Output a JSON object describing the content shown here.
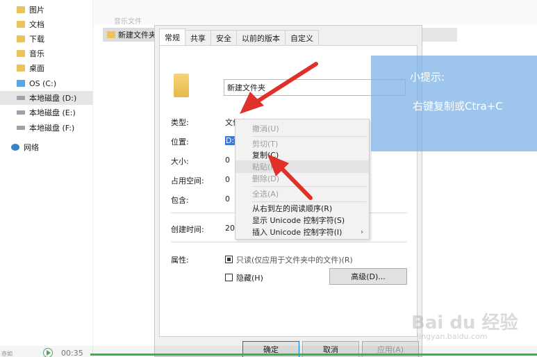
{
  "nav": {
    "items": [
      {
        "label": "图片",
        "icon": "folder-icon"
      },
      {
        "label": "文档",
        "icon": "folder-icon"
      },
      {
        "label": "下载",
        "icon": "folder-icon"
      },
      {
        "label": "音乐",
        "icon": "folder-icon"
      },
      {
        "label": "桌面",
        "icon": "folder-icon"
      },
      {
        "label": "OS (C:)",
        "icon": "windows-drive-icon"
      },
      {
        "label": "本地磁盘 (D:)",
        "icon": "drive-icon",
        "selected": true
      },
      {
        "label": "本地磁盘 (E:)",
        "icon": "drive-icon"
      },
      {
        "label": "本地磁盘 (F:)",
        "icon": "drive-icon"
      },
      {
        "label": "网络",
        "icon": "network-icon"
      }
    ]
  },
  "background": {
    "faint_item": "音乐文件",
    "selected_row": "新建文件夹"
  },
  "dialog": {
    "tabs": [
      "常规",
      "共享",
      "安全",
      "以前的版本",
      "自定义"
    ],
    "active_tab": "常规",
    "name": "新建文件夹",
    "props": {
      "type_label": "类型:",
      "type_value": "文件夹",
      "location_label": "位置:",
      "location_value": "D:\\",
      "size_label": "大小:",
      "size_value": "0",
      "size_on_disk_label": "占用空间:",
      "size_on_disk_value": "0",
      "contains_label": "包含:",
      "contains_value": "0",
      "created_label": "创建时间:",
      "created_value": "20",
      "attributes_label": "属性:"
    },
    "attributes": {
      "readonly_label": "只读(仅应用于文件夹中的文件)(R)",
      "hidden_label": "隐藏(H)",
      "advanced_button": "高级(D)..."
    },
    "buttons": {
      "ok": "确定",
      "cancel": "取消",
      "apply": "应用(A)"
    }
  },
  "context_menu": {
    "items": [
      {
        "label": "撤消(U)",
        "disabled": true
      },
      {
        "separator": true
      },
      {
        "label": "剪切(T)",
        "disabled": true
      },
      {
        "label": "复制(C)",
        "disabled": false
      },
      {
        "label": "粘贴(P)",
        "disabled": true,
        "hover": true
      },
      {
        "label": "删除(D)",
        "disabled": true
      },
      {
        "separator": true
      },
      {
        "label": "全选(A)",
        "disabled": true
      },
      {
        "separator": true
      },
      {
        "label": "从右到左的阅读顺序(R)",
        "disabled": false
      },
      {
        "label": "显示 Unicode 控制字符(S)",
        "disabled": false
      },
      {
        "label": "插入 Unicode 控制字符(I)",
        "disabled": false,
        "submenu": true
      }
    ]
  },
  "tip": {
    "title": "小提示:",
    "body": "右键复制或Ctra+C"
  },
  "video": {
    "time": "00:35",
    "corner": "亦如"
  },
  "watermark": {
    "main": "Bai du 经验",
    "sub": "jingyan.baidu.com"
  },
  "colors": {
    "accent_selection": "#3b78d8",
    "tip_background": "#78aee4",
    "arrow": "#e0302a",
    "progress": "#35b34a"
  }
}
